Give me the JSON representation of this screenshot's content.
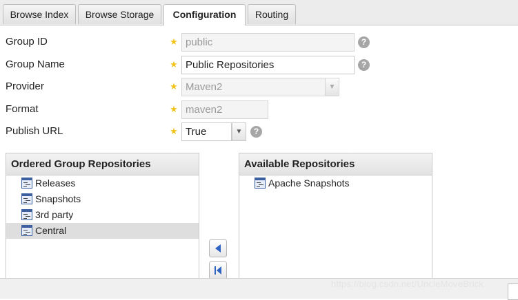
{
  "tabs": [
    {
      "label": "Browse Index",
      "active": false
    },
    {
      "label": "Browse Storage",
      "active": false
    },
    {
      "label": "Configuration",
      "active": true
    },
    {
      "label": "Routing",
      "active": false
    }
  ],
  "form": {
    "group_id": {
      "label": "Group ID",
      "value": "public",
      "disabled": true
    },
    "group_name": {
      "label": "Group Name",
      "value": "Public Repositories",
      "disabled": false
    },
    "provider": {
      "label": "Provider",
      "value": "Maven2",
      "disabled": true
    },
    "format": {
      "label": "Format",
      "value": "maven2",
      "disabled": true
    },
    "publish_url": {
      "label": "Publish URL",
      "value": "True",
      "options": [
        "True"
      ]
    }
  },
  "ordered_panel": {
    "title": "Ordered Group Repositories",
    "items": [
      "Releases",
      "Snapshots",
      "3rd party",
      "Central"
    ],
    "selected_index": 3
  },
  "available_panel": {
    "title": "Available Repositories",
    "items": [
      "Apache Snapshots"
    ]
  },
  "watermark": "https://blog.csdn.net/UncleMoveBrick",
  "colors": {
    "required_star": "#f0c419",
    "icon_blue": "#3c5f9f",
    "selected_row": "#dedede"
  }
}
